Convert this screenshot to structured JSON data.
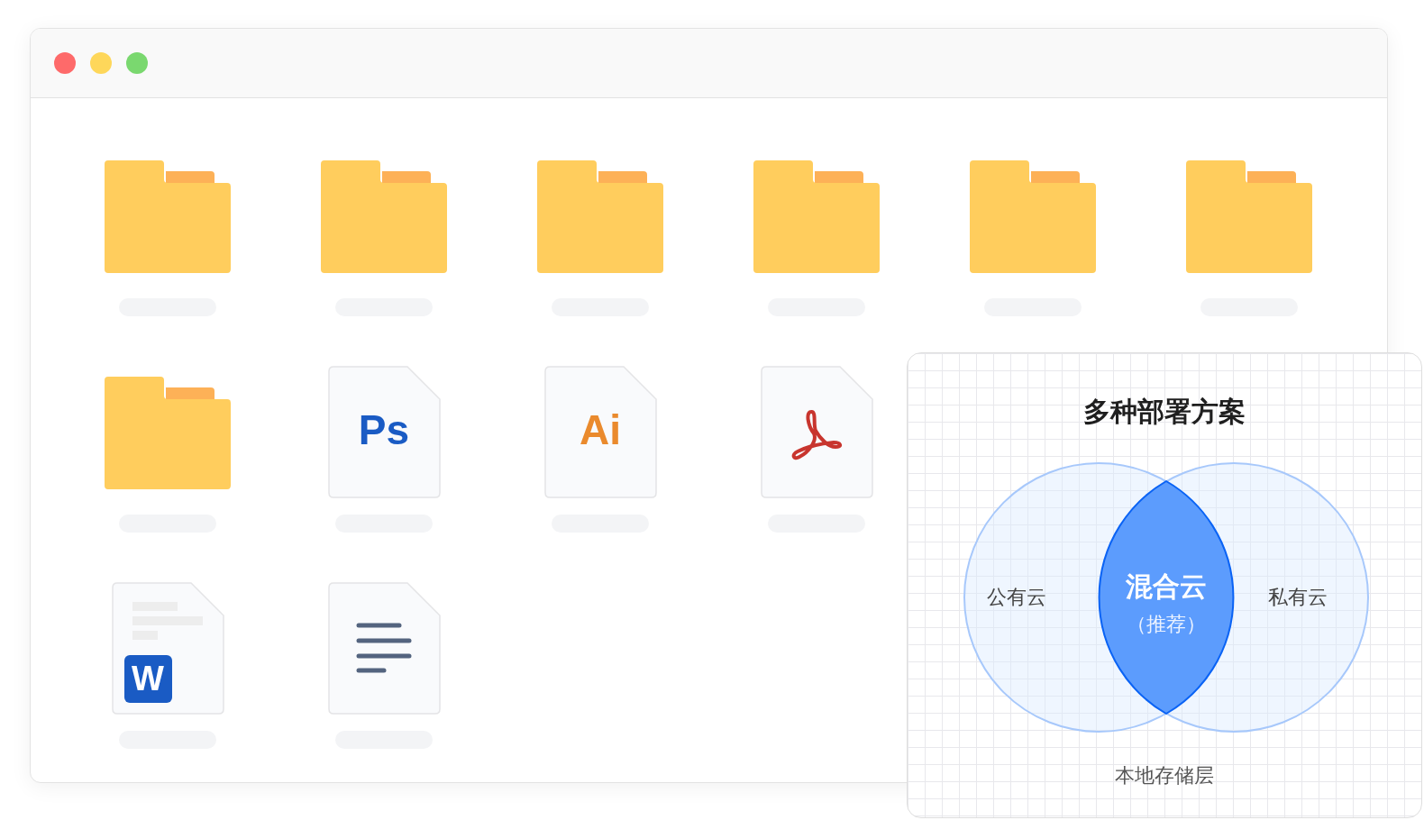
{
  "file_rows": [
    [
      {
        "kind": "folder"
      },
      {
        "kind": "folder"
      },
      {
        "kind": "folder"
      },
      {
        "kind": "folder"
      },
      {
        "kind": "folder"
      },
      {
        "kind": "folder"
      }
    ],
    [
      {
        "kind": "folder"
      },
      {
        "kind": "ps",
        "badge": "Ps"
      },
      {
        "kind": "ai",
        "badge": "Ai"
      },
      {
        "kind": "pdf"
      }
    ],
    [
      {
        "kind": "word",
        "badge": "W"
      },
      {
        "kind": "text"
      }
    ]
  ],
  "deployment_panel": {
    "title": "多种部署方案",
    "left_circle": "公有云",
    "right_circle": "私有云",
    "overlap": "混合云",
    "overlap_note": "（推荐）",
    "base_layer": "本地存储层"
  }
}
